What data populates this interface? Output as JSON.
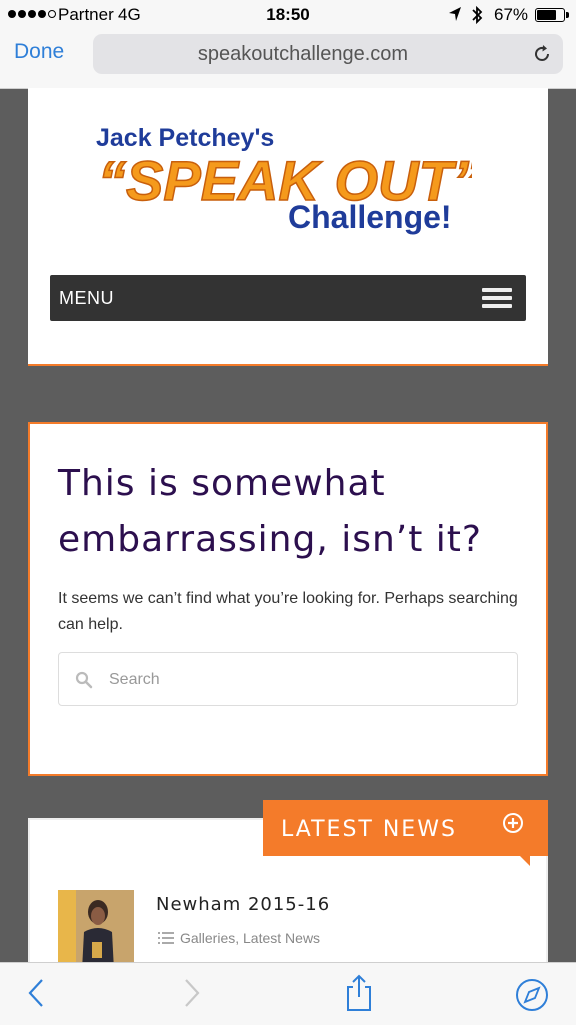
{
  "status_bar": {
    "carrier": "Partner",
    "network": "4G",
    "time": "18:50",
    "battery": "67%",
    "battery_level": 0.67
  },
  "browser": {
    "done_label": "Done",
    "url": "speakoutchallenge.com"
  },
  "header": {
    "logo_line1": "Jack Petchey's",
    "logo_line2": "“SPEAK OUT”",
    "logo_line3": "Challenge!",
    "menu_label": "MENU"
  },
  "error": {
    "title": "This is somewhat embarrassing, isn’t it?",
    "text": "It seems we can’t find what you’re looking for. Perhaps searching can help.",
    "search_placeholder": "Search"
  },
  "news": {
    "tab_label": "LATEST NEWS",
    "items": [
      {
        "title": "Newham 2015-16",
        "categories": "Galleries, Latest News"
      }
    ]
  },
  "colors": {
    "accent": "#f47b2a",
    "title": "#2c0f4e",
    "link_blue": "#2f7fd8",
    "menu_bg": "#333333"
  }
}
